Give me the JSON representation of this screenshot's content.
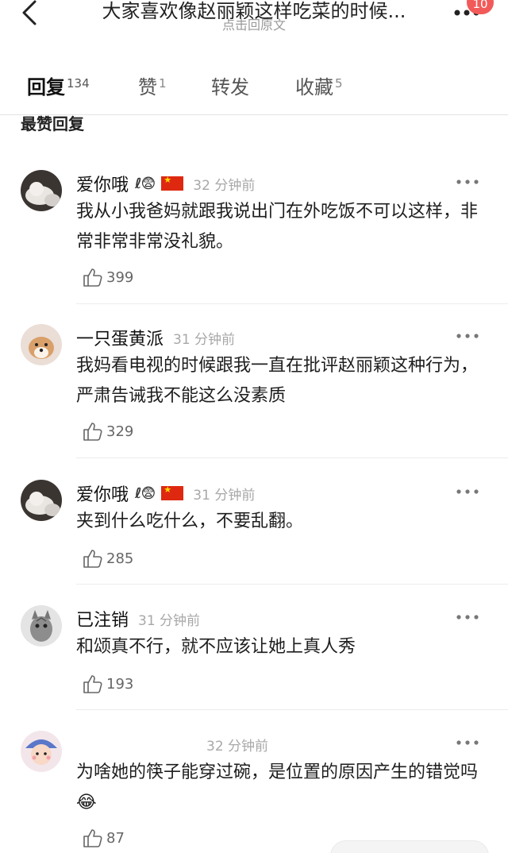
{
  "header": {
    "title": "大家喜欢像赵丽颖这样吃菜的时候...",
    "subtitle": "点击回原文",
    "badge": "10"
  },
  "tabs": [
    {
      "label": "回复",
      "count": "134",
      "active": true
    },
    {
      "label": "赞",
      "count": "1",
      "active": false
    },
    {
      "label": "转发",
      "count": "",
      "active": false
    },
    {
      "label": "收藏",
      "count": "5",
      "active": false
    }
  ],
  "section_title": "最赞回复",
  "comments": [
    {
      "name": "爱你哦",
      "badge": "ℓ😨",
      "time": "32 分钟前",
      "text": "我从小我爸妈就跟我说出门在外吃饭不可以这样，非常非常非常没礼貌。",
      "likes": "399",
      "flag": true
    },
    {
      "name": "一只蛋黄派",
      "badge": "",
      "time": "31 分钟前",
      "text": "我妈看电视的时候跟我一直在批评赵丽颖这种行为，严肃告诫我不能这么没素质",
      "likes": "329",
      "flag": false
    },
    {
      "name": "爱你哦",
      "badge": "ℓ😨",
      "time": "31 分钟前",
      "text": "夹到什么吃什么，不要乱翻。",
      "likes": "285",
      "flag": true
    },
    {
      "name": "已注销",
      "badge": "",
      "time": "31 分钟前",
      "text": "和颂真不行，就不应该让她上真人秀",
      "likes": "193",
      "flag": false
    },
    {
      "name": "",
      "badge": "",
      "time": "32 分钟前",
      "text": "为啥她的筷子能穿过碗，是位置的原因产生的错觉吗😂",
      "likes": "87",
      "flag": false
    }
  ],
  "icons": {
    "back": "chevron-left-icon",
    "more": "more-dots-icon",
    "like": "thumbs-up-icon"
  },
  "colors": {
    "badge": "#f25a5a",
    "muted": "#a8a8a8"
  }
}
